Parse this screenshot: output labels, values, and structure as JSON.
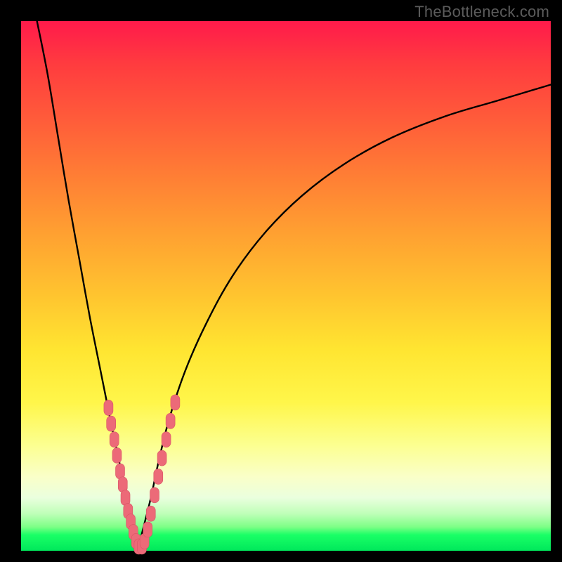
{
  "watermark": "TheBottleneck.com",
  "colors": {
    "curve": "#000000",
    "marker_fill": "#ec6a78",
    "marker_stroke": "#d95566",
    "frame": "#000000"
  },
  "chart_data": {
    "type": "line",
    "title": "",
    "xlabel": "",
    "ylabel": "",
    "xlim": [
      0,
      100
    ],
    "ylim": [
      0,
      100
    ],
    "legend": false,
    "grid": false,
    "description": "Bottleneck-percentage style V-curve. Y is interpreted as bottleneck percent (0 at bottom / green = balanced, 100 at top / red = severe bottleneck). The curve minimum (≈0% bottleneck) occurs near x≈22. Two branches rise steeply on either side; the right branch is shallower and asymptotes toward ≈88%.",
    "series": [
      {
        "name": "left-branch",
        "x": [
          3,
          5,
          7,
          9,
          11,
          13,
          15,
          17,
          18.5,
          20,
          21,
          22
        ],
        "y": [
          100,
          90,
          78,
          66,
          55,
          44,
          34,
          24,
          17,
          9,
          4,
          0
        ]
      },
      {
        "name": "right-branch",
        "x": [
          22,
          23,
          24.5,
          26,
          28,
          31,
          35,
          40,
          46,
          53,
          61,
          70,
          80,
          90,
          100
        ],
        "y": [
          0,
          4,
          10,
          17,
          25,
          34,
          43,
          52,
          60,
          67,
          73,
          78,
          82,
          85,
          88
        ]
      }
    ],
    "markers": {
      "name": "sample-points",
      "note": "Salmon rounded markers clustered near the valley on both branches",
      "points": [
        {
          "x": 16.5,
          "y": 27
        },
        {
          "x": 17.0,
          "y": 24
        },
        {
          "x": 17.6,
          "y": 21
        },
        {
          "x": 18.1,
          "y": 18
        },
        {
          "x": 18.7,
          "y": 15
        },
        {
          "x": 19.2,
          "y": 12.5
        },
        {
          "x": 19.7,
          "y": 10
        },
        {
          "x": 20.2,
          "y": 7.5
        },
        {
          "x": 20.7,
          "y": 5.5
        },
        {
          "x": 21.2,
          "y": 3.5
        },
        {
          "x": 21.7,
          "y": 1.8
        },
        {
          "x": 22.2,
          "y": 0.8
        },
        {
          "x": 22.8,
          "y": 0.8
        },
        {
          "x": 23.3,
          "y": 1.8
        },
        {
          "x": 23.9,
          "y": 4
        },
        {
          "x": 24.5,
          "y": 7
        },
        {
          "x": 25.2,
          "y": 10.5
        },
        {
          "x": 25.9,
          "y": 14
        },
        {
          "x": 26.6,
          "y": 17.5
        },
        {
          "x": 27.4,
          "y": 21
        },
        {
          "x": 28.2,
          "y": 24.5
        },
        {
          "x": 29.1,
          "y": 28
        }
      ]
    }
  }
}
